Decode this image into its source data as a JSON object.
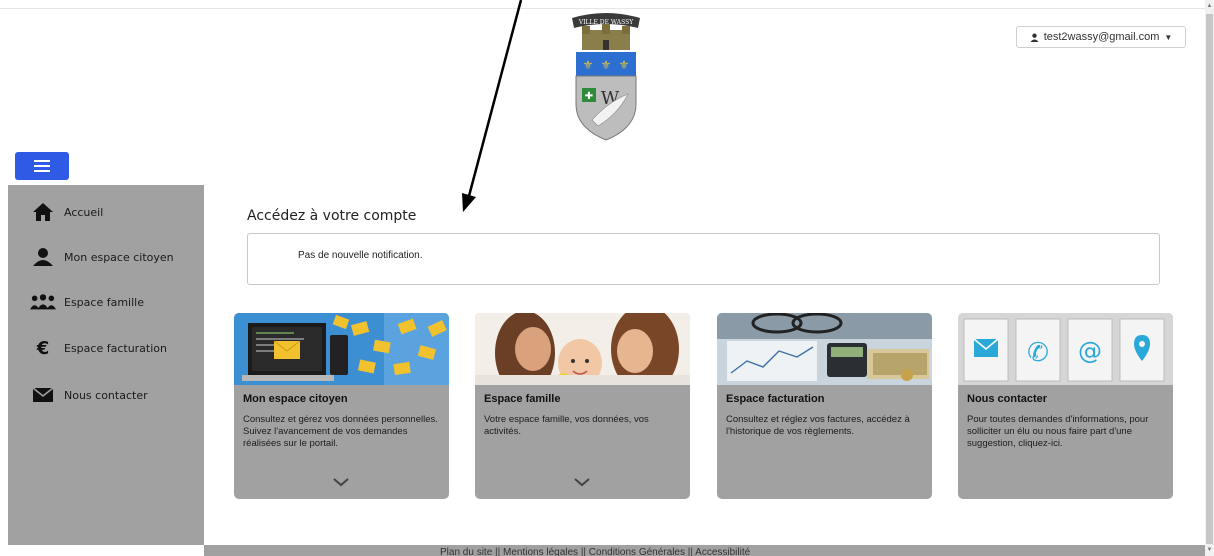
{
  "header": {
    "logo_alt": "VILLE DE WASSY",
    "user_email": "test2wassy@gmail.com"
  },
  "sidebar": {
    "items": [
      {
        "label": "Accueil",
        "icon": "home-icon"
      },
      {
        "label": "Mon espace citoyen",
        "icon": "user-icon"
      },
      {
        "label": "Espace famille",
        "icon": "family-icon"
      },
      {
        "label": "Espace facturation",
        "icon": "euro-icon"
      },
      {
        "label": "Nous contacter",
        "icon": "envelope-icon"
      }
    ]
  },
  "main": {
    "title": "Accédez à votre compte",
    "notification": "Pas de nouvelle notification."
  },
  "cards": [
    {
      "title": "Mon espace citoyen",
      "description": "Consultez et gérez vos données personnelles. Suivez l'avancement de vos demandes réalisées sur le portail."
    },
    {
      "title": "Espace famille",
      "description": "Votre espace famille, vos données, vos activités."
    },
    {
      "title": "Espace facturation",
      "description": "Consultez et réglez vos factures, accédez à l'historique de vos règlements."
    },
    {
      "title": "Nous contacter",
      "description": "Pour toutes demandes d'informations, pour solliciter un élu ou nous faire part d'une suggestion, cliquez-ici."
    }
  ],
  "footer": {
    "links": "Plan du site || Mentions légales || Conditions Générales || Accessibilité"
  },
  "colors": {
    "menu_button": "#2e5ae6",
    "sidebar_bg": "#a1a1a1",
    "card_bg": "#a1a1a1"
  }
}
